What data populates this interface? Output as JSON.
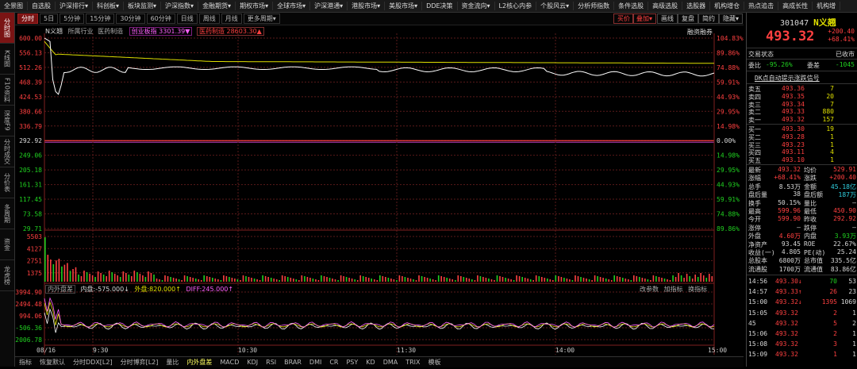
{
  "menu": [
    "全景图",
    "自选股",
    "沪深排行▾",
    "科创板▾",
    "板块监测▾",
    "沪深指数▾",
    "金融期货▾",
    "期权市场▾",
    "全球市场▾",
    "沪深港通▾",
    "港股市场▾",
    "美股市场▾",
    "DDE决策",
    "资金流向▾",
    "L2核心内参",
    "个股风云▾",
    "分析师指数",
    "条件选股",
    "高级选股",
    "选股器",
    "机构增仓",
    "热点追击",
    "高成长性",
    "机构增"
  ],
  "left_tabs": [
    "分时图",
    "K线图",
    "F10资料",
    "深度F9",
    "分时成交",
    "分价表",
    "多周期",
    "资金",
    "龙虎榜"
  ],
  "period_tabs": [
    "分时",
    "5日",
    "5分钟",
    "15分钟",
    "30分钟",
    "60分钟",
    "日线",
    "周线",
    "月线",
    "更多周期▾"
  ],
  "toolbar_right": {
    "buy": "买价",
    "add": "叠加▾",
    "stat": "画线",
    "review": "复盘",
    "brief": "简约",
    "hide": "隐藏▾"
  },
  "info": {
    "name": "N义翘",
    "industry": "所属行业",
    "industry_val": "医药制造",
    "index1": "创业板指 3301.39▼",
    "index2": "医药制造 28603.30▲",
    "mode": "融资融券"
  },
  "price_axis_left": [
    "600.00",
    "556.13",
    "512.26",
    "468.39",
    "424.53",
    "380.66",
    "336.79",
    "292.92",
    "249.06",
    "205.18",
    "161.31",
    "117.45",
    "73.58",
    "29.71"
  ],
  "price_axis_right": [
    "104.83%",
    "89.86%",
    "74.88%",
    "59.91%",
    "44.93%",
    "29.95%",
    "14.98%",
    "0.00%",
    "14.98%",
    "29.95%",
    "44.93%",
    "59.91%",
    "74.88%",
    "89.86%"
  ],
  "volume_axis": [
    "5503",
    "4127",
    "2751",
    "1375"
  ],
  "flow": {
    "label": "内外盘差",
    "inner": "内盘:-575.000↓",
    "outer": "外盘:820.000↑",
    "diff": "DIFF:245.000↑",
    "btn1": "改参数",
    "btn2": "加指标",
    "btn3": "换指标"
  },
  "flow_axis": [
    "3994.90",
    "2494.48",
    "994.06",
    "-506.36",
    "-2006.78"
  ],
  "time_axis": [
    "08/16",
    "9:30",
    "10:30",
    "11:30",
    "14:00",
    "15:00"
  ],
  "bottom_tabs": [
    "指标",
    "恢复默认",
    "分时DDX[L2]",
    "分时博弈[L2]",
    "量比",
    "内外盘差",
    "MACD",
    "KDJ",
    "RSI",
    "BRAR",
    "DMI",
    "CR",
    "PSY",
    "KD",
    "DMA",
    "TRIX",
    "模板"
  ],
  "stock": {
    "code": "301047",
    "name": "N义翘",
    "price": "493.32",
    "change": "+200.40",
    "pct": "+68.41%",
    "status_label": "交易状态",
    "status_val": "已收市",
    "wb_label": "委比",
    "wb_val": "-95.26%",
    "wc_label": "委差",
    "wc_val": "-1045",
    "dde": "DK点自动提示涨跌信号"
  },
  "asks": [
    [
      "卖五",
      "493.36",
      "7"
    ],
    [
      "卖四",
      "493.35",
      "20"
    ],
    [
      "卖三",
      "493.34",
      "7"
    ],
    [
      "卖二",
      "493.33",
      "880"
    ],
    [
      "卖一",
      "493.32",
      "157"
    ]
  ],
  "bids": [
    [
      "买一",
      "493.30",
      "19"
    ],
    [
      "买二",
      "493.28",
      "1"
    ],
    [
      "买三",
      "493.23",
      "1"
    ],
    [
      "买四",
      "493.11",
      "4"
    ],
    [
      "买五",
      "493.10",
      "1"
    ]
  ],
  "quote": [
    [
      "最新",
      "493.32",
      "均价",
      "529.91"
    ],
    [
      "涨幅",
      "+68.41%",
      "涨跌",
      "+200.40"
    ],
    [
      "总手",
      "8.53万",
      "金额",
      "45.18亿"
    ],
    [
      "盘后量",
      "38",
      "盘后额",
      "187万"
    ],
    [
      "换手",
      "50.15%",
      "量比",
      "—"
    ],
    [
      "最高",
      "599.96",
      "最低",
      "450.90"
    ],
    [
      "今开",
      "599.90",
      "昨收",
      "292.92"
    ],
    [
      "涨停",
      "—",
      "跌停",
      "—"
    ],
    [
      "外盘",
      "4.60万",
      "内盘",
      "3.93万"
    ],
    [
      "净资产",
      "93.45",
      "ROE",
      "22.67%"
    ],
    [
      "收益(一)",
      "4.805",
      "PE(动)",
      "25.24"
    ],
    [
      "总股本",
      "6800万",
      "总市值",
      "335.5亿"
    ],
    [
      "流通股",
      "1700万",
      "流通值",
      "83.86亿"
    ]
  ],
  "ticks": [
    [
      "14:56",
      "493.30↓",
      "70",
      "53"
    ],
    [
      "14:57",
      "493.33↑",
      "26",
      "23"
    ],
    [
      "15:00",
      "493.32↓",
      "1395",
      "1069"
    ],
    [
      "15:05",
      "493.32",
      "2",
      "1"
    ],
    [
      "45",
      "493.32",
      "5",
      "2"
    ],
    [
      "15:06",
      "493.32",
      "2",
      "1"
    ],
    [
      "15:08",
      "493.32",
      "3",
      "1"
    ],
    [
      "15:09",
      "493.32",
      "1",
      "1"
    ]
  ],
  "colors": {
    "up": "#ff4040",
    "down": "#20d020",
    "price_line": "#ffffff",
    "avg_line": "#e0e000",
    "grid": "#5a1a1a"
  }
}
